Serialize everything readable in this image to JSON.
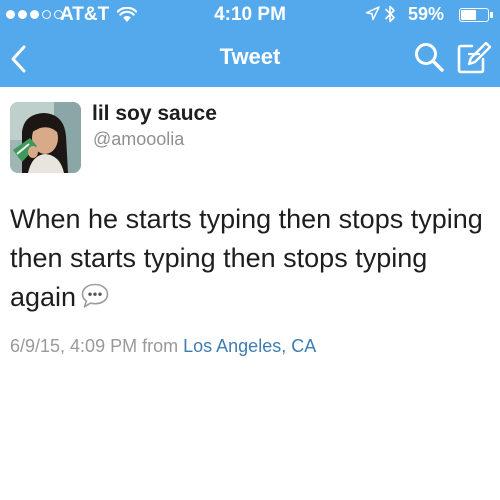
{
  "status_bar": {
    "signal": {
      "filled": 3,
      "total": 5
    },
    "carrier": "AT&T",
    "time": "4:10 PM",
    "battery_percent_label": "59%",
    "battery_level": 0.59
  },
  "nav": {
    "title": "Tweet",
    "back_icon": "chevron-left-icon",
    "search_icon": "search-icon",
    "compose_icon": "compose-icon"
  },
  "tweet": {
    "author": {
      "name": "lil soy sauce",
      "handle": "@amooolia"
    },
    "text": "When he starts typing then stops typing then starts typing then stops typing again",
    "emoji_icon": "speech-bubble-ellipsis-icon",
    "timestamp": "6/9/15, 4:09 PM",
    "from_label": "from",
    "location": "Los Angeles, CA"
  },
  "colors": {
    "nav_background": "#54a8ec",
    "text": "#1e1e1e",
    "secondary_text": "#8f8f8f",
    "link": "#3f7cb3"
  }
}
